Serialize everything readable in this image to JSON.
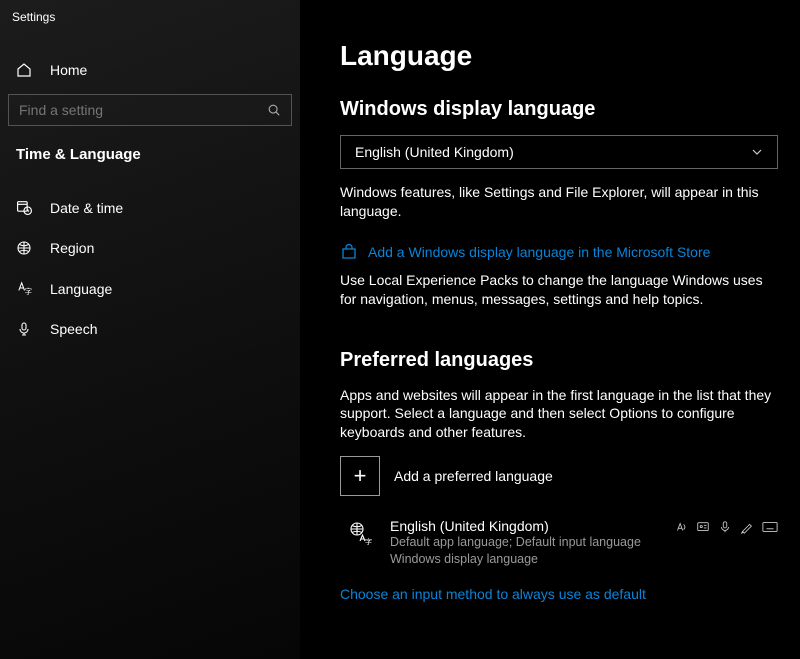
{
  "app_title": "Settings",
  "home_label": "Home",
  "search": {
    "placeholder": "Find a setting"
  },
  "category_label": "Time & Language",
  "sidebar": {
    "items": [
      {
        "label": "Date & time"
      },
      {
        "label": "Region"
      },
      {
        "label": "Language"
      },
      {
        "label": "Speech"
      }
    ]
  },
  "main": {
    "title": "Language",
    "display_section": {
      "heading": "Windows display language",
      "selected": "English (United Kingdom)",
      "description": "Windows features, like Settings and File Explorer, will appear in this language.",
      "store_link": "Add a Windows display language in the Microsoft Store",
      "store_desc": "Use Local Experience Packs to change the language Windows uses for navigation, menus, messages, settings and help topics."
    },
    "preferred_section": {
      "heading": "Preferred languages",
      "description": "Apps and websites will appear in the first language in the list that they support. Select a language and then select Options to configure keyboards and other features.",
      "add_label": "Add a preferred language",
      "language": {
        "name": "English (United Kingdom)",
        "sub1": "Default app language; Default input language",
        "sub2": "Windows display language"
      },
      "bottom_link": "Choose an input method to always use as default"
    }
  }
}
